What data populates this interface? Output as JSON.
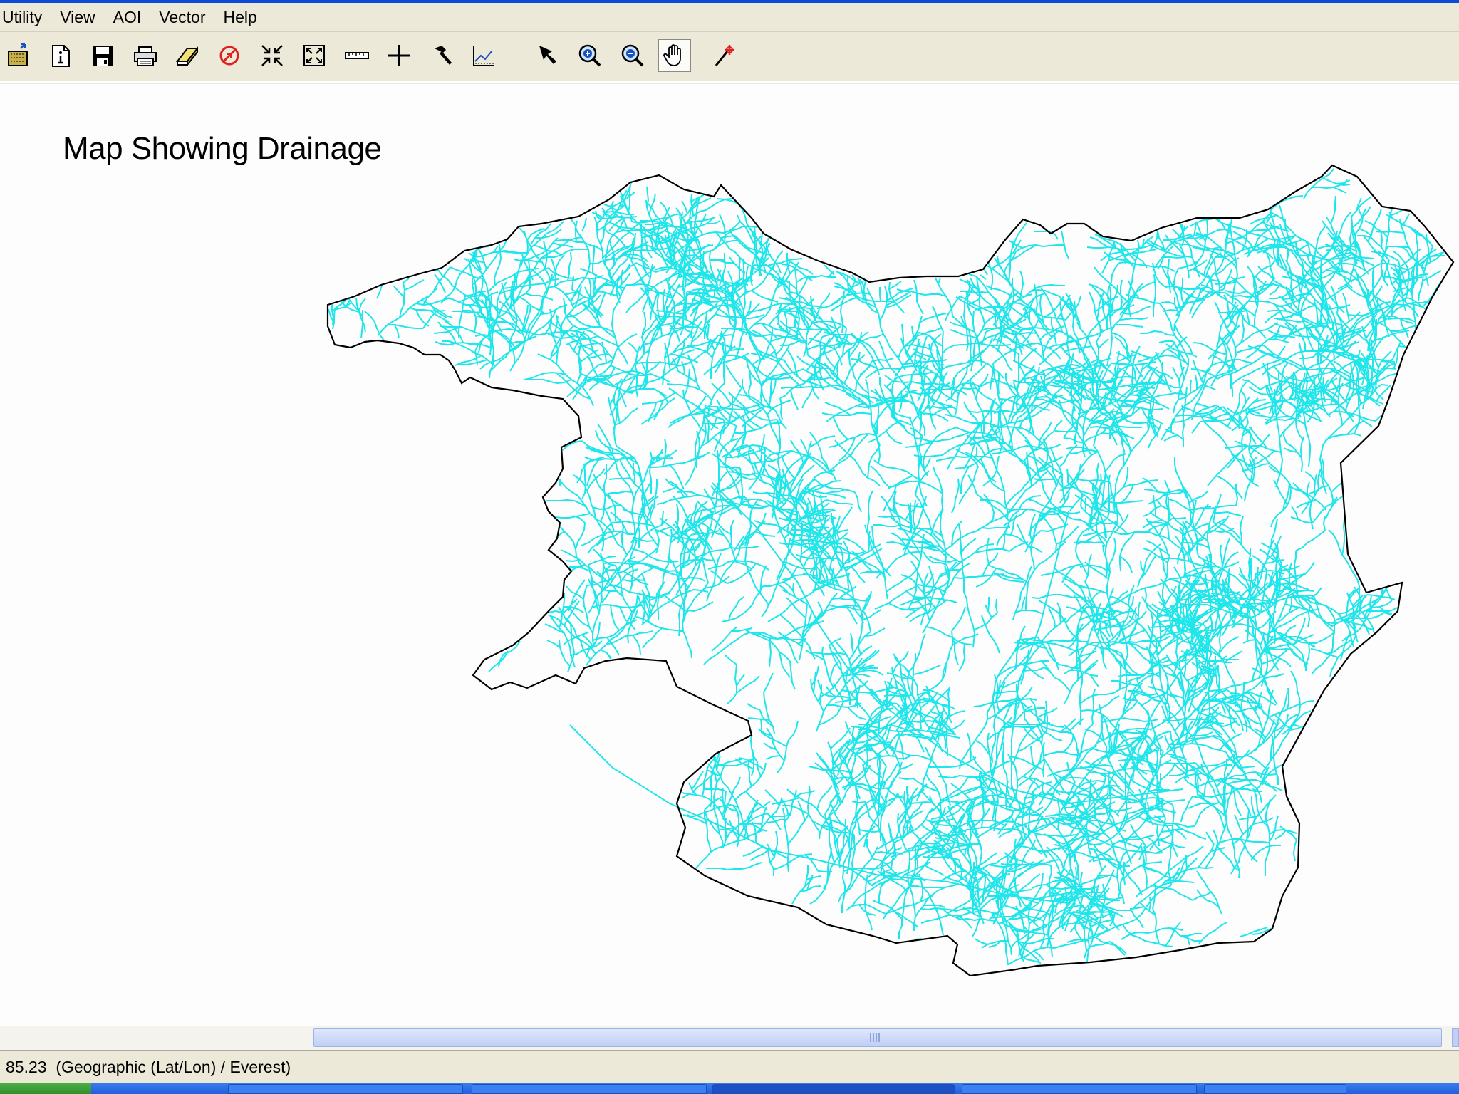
{
  "menu": {
    "items": [
      "Utility",
      "View",
      "AOI",
      "Vector",
      "Help"
    ]
  },
  "toolbar": {
    "tools": [
      {
        "icon": "open-layer-icon"
      },
      {
        "icon": "layer-info-icon"
      },
      {
        "icon": "save-icon"
      },
      {
        "icon": "print-icon"
      },
      {
        "icon": "eraser-icon"
      },
      {
        "icon": "clear-view-icon"
      },
      {
        "icon": "zoom-in-full-icon"
      },
      {
        "icon": "fit-to-frame-icon"
      },
      {
        "icon": "measure-icon"
      },
      {
        "icon": "crosshair-icon"
      },
      {
        "icon": "hammer-icon"
      },
      {
        "icon": "profile-chart-icon"
      },
      {
        "icon": "select-arrow-icon"
      },
      {
        "icon": "zoom-in-icon"
      },
      {
        "icon": "zoom-out-icon"
      },
      {
        "icon": "pan-hand-icon",
        "pressed": true
      },
      {
        "icon": "inquire-cursor-icon"
      }
    ]
  },
  "map": {
    "title": "Map Showing Drainage",
    "boundary_color": "#000000",
    "drainage_color": "#1ee6ea",
    "background": "#fdfdfd"
  },
  "status": {
    "text": "85.23  (Geographic (Lat/Lon) / Everest)"
  },
  "colors": {
    "chrome": "#ece9d8",
    "title_bar": "#0a4bd8",
    "scroll_thumb": "#bfcff5"
  }
}
